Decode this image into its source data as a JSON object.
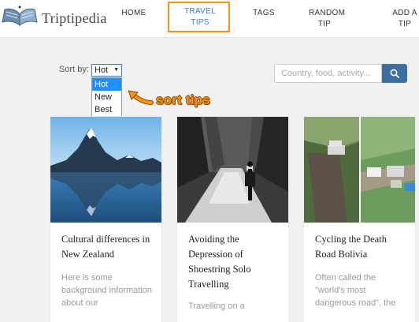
{
  "header": {
    "logo_text": "Triptipedia",
    "nav": {
      "home": "HOME",
      "travel_tips_line1": "TRAVEL",
      "travel_tips_line2": "TIPS",
      "tags": "TAGS",
      "random_tip_line1": "RANDOM",
      "random_tip_line2": "TIP",
      "add_tip_line1": "ADD A",
      "add_tip_line2": "TIP"
    }
  },
  "sort": {
    "label": "Sort by:",
    "selected": "Hot",
    "options": [
      "Hot",
      "New",
      "Best"
    ]
  },
  "annotation": {
    "text": "sort tips",
    "color": "#f5931e"
  },
  "search": {
    "placeholder": "Country, food, activity...",
    "value": ""
  },
  "cards": [
    {
      "title": "Cultural differences in New Zealand",
      "excerpt": "Here is some background information about our"
    },
    {
      "title": "Avoiding the Depression of Shoestring Solo Travelling",
      "excerpt": "Travelling on a"
    },
    {
      "title": "Cycling the Death Road Bolivia",
      "excerpt": "Often called the \"world's most dangerous road\", the"
    }
  ],
  "colors": {
    "accent": "#3a7dc0",
    "highlight": "#f5931e",
    "search_button": "#3d6f9e"
  }
}
